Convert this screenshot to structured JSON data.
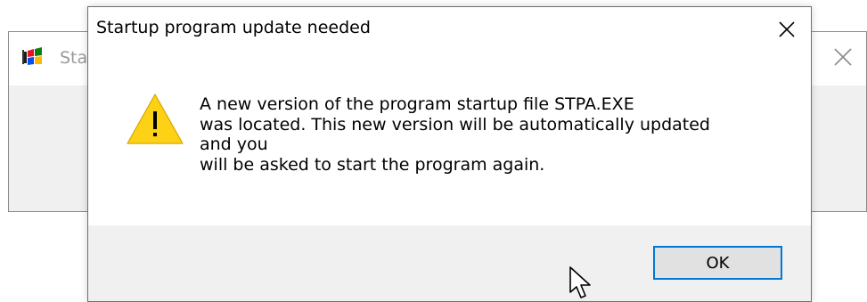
{
  "background_window": {
    "title": "Sta",
    "icon": "windows-flag-icon",
    "close_icon": "close-icon"
  },
  "dialog": {
    "title": "Startup program update needed",
    "close_icon": "close-icon",
    "warning_icon": "warning-icon",
    "message_lines": [
      "A new version of the program startup file STPA.EXE",
      "was located.  This new version will be automatically updated",
      "and you",
      "will be asked to start the program again."
    ],
    "ok_label": "OK"
  },
  "cursor": {
    "icon": "mouse-pointer-icon"
  },
  "colors": {
    "accent": "#0078d7",
    "footer_bg": "#f0f0f0",
    "warning_yellow": "#fcd116"
  }
}
